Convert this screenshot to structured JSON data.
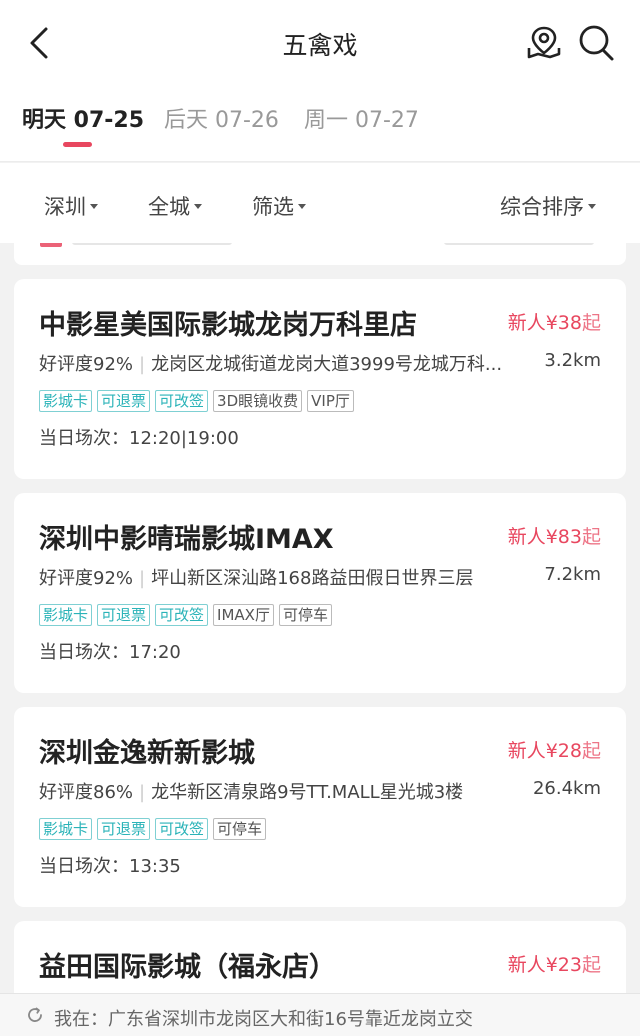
{
  "header": {
    "title": "五禽戏",
    "back_icon": "chevron-left-icon",
    "map_icon": "map-pin-icon",
    "search_icon": "search-icon"
  },
  "date_tabs": [
    {
      "label": "明天 07-25",
      "active": true
    },
    {
      "label": "后天 07-26",
      "active": false
    },
    {
      "label": "周一 07-27",
      "active": false
    }
  ],
  "filters": {
    "city": "深圳",
    "area": "全城",
    "filter": "筛选",
    "sort": "综合排序"
  },
  "cinemas": [
    {
      "name": "中影星美国际影城龙岗万科里店",
      "price_prefix": "新人¥",
      "price": "38",
      "price_suffix": "起",
      "rating": "好评度92%",
      "address": "龙岗区龙城街道龙岗大道3999号龙城万科...",
      "distance": "3.2km",
      "tags": [
        {
          "label": "影城卡",
          "style": "teal"
        },
        {
          "label": "可退票",
          "style": "teal"
        },
        {
          "label": "可改签",
          "style": "teal"
        },
        {
          "label": "3D眼镜收费",
          "style": "gray"
        },
        {
          "label": "VIP厅",
          "style": "gray"
        }
      ],
      "showtimes": "当日场次：12:20|19:00"
    },
    {
      "name": "深圳中影晴瑞影城IMAX",
      "price_prefix": "新人¥",
      "price": "83",
      "price_suffix": "起",
      "rating": "好评度92%",
      "address": "坪山新区深汕路168路益田假日世界三层",
      "distance": "7.2km",
      "tags": [
        {
          "label": "影城卡",
          "style": "teal"
        },
        {
          "label": "可退票",
          "style": "teal"
        },
        {
          "label": "可改签",
          "style": "teal"
        },
        {
          "label": "IMAX厅",
          "style": "gray"
        },
        {
          "label": "可停车",
          "style": "gray"
        }
      ],
      "showtimes": "当日场次：17:20"
    },
    {
      "name": "深圳金逸新新影城",
      "price_prefix": "新人¥",
      "price": "28",
      "price_suffix": "起",
      "rating": "好评度86%",
      "address": "龙华新区清泉路9号TT.MALL星光城3楼",
      "distance": "26.4km",
      "tags": [
        {
          "label": "影城卡",
          "style": "teal"
        },
        {
          "label": "可退票",
          "style": "teal"
        },
        {
          "label": "可改签",
          "style": "teal"
        },
        {
          "label": "可停车",
          "style": "gray"
        }
      ],
      "showtimes": "当日场次：13:35"
    },
    {
      "name": "益田国际影城（福永店）",
      "price_prefix": "新人¥",
      "price": "23",
      "price_suffix": "起"
    }
  ],
  "location": {
    "text": "我在：广东省深圳市龙岗区大和街16号靠近龙岗立交",
    "icon": "refresh-icon"
  },
  "colors": {
    "accent": "#e8475f",
    "tag_teal": "#2ab3b8"
  }
}
